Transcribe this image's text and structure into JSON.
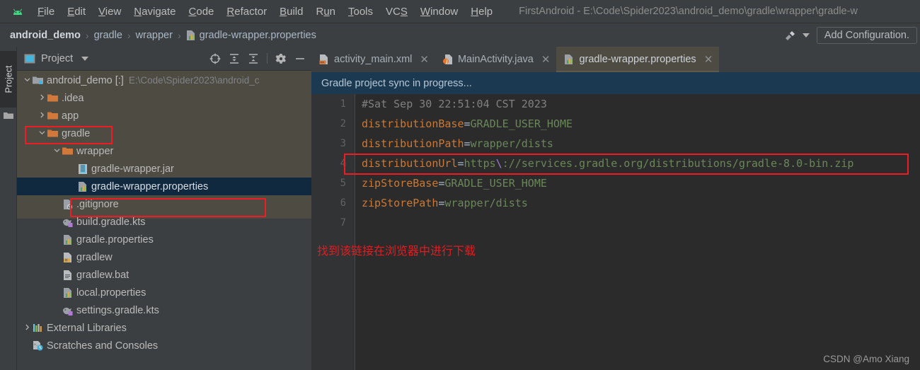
{
  "window": {
    "title": "FirstAndroid - E:\\Code\\Spider2023\\android_demo\\gradle\\wrapper\\gradle-w",
    "app_icon": "android-logo-icon"
  },
  "menubar": {
    "items": [
      {
        "label": "File",
        "mnemonic": "F"
      },
      {
        "label": "Edit",
        "mnemonic": "E"
      },
      {
        "label": "View",
        "mnemonic": "V"
      },
      {
        "label": "Navigate",
        "mnemonic": "N"
      },
      {
        "label": "Code",
        "mnemonic": "C"
      },
      {
        "label": "Refactor",
        "mnemonic": "R"
      },
      {
        "label": "Build",
        "mnemonic": "B"
      },
      {
        "label": "Run",
        "mnemonic": "u"
      },
      {
        "label": "Tools",
        "mnemonic": "T"
      },
      {
        "label": "VCS",
        "mnemonic": "S"
      },
      {
        "label": "Window",
        "mnemonic": "W"
      },
      {
        "label": "Help",
        "mnemonic": "H"
      }
    ]
  },
  "breadcrumb": {
    "separator": "›",
    "items": [
      {
        "label": "android_demo",
        "icon": ""
      },
      {
        "label": "gradle",
        "icon": ""
      },
      {
        "label": "wrapper",
        "icon": ""
      },
      {
        "label": "gradle-wrapper.properties",
        "icon": "properties-file-icon"
      }
    ]
  },
  "toolbar_right": {
    "device_icon": "run-device-icon",
    "dropdown_icon": "chevron-down-icon",
    "add_configuration_label": "Add Configuration."
  },
  "tool_window_strip": {
    "project_tab_label": "Project",
    "folder_icon": "folder-icon"
  },
  "project_panel": {
    "title": "Project",
    "dropdown_icon": "chevron-down-icon",
    "icons": [
      {
        "name": "locate-target-icon"
      },
      {
        "name": "expand-all-icon"
      },
      {
        "name": "collapse-all-icon"
      },
      {
        "name": "settings-gear-icon"
      },
      {
        "name": "hide-minimize-icon"
      }
    ],
    "tree": [
      {
        "label": "android_demo",
        "suffix": "[:]",
        "subpath": "E:\\Code\\Spider2023\\android_c",
        "indent": 0,
        "arrow": "expanded",
        "icon": "module-icon",
        "selected": false,
        "highlight": false
      },
      {
        "label": ".idea",
        "subpath": "",
        "indent": 1,
        "arrow": "collapsed",
        "icon": "folder-icon",
        "selected": false,
        "highlight": false
      },
      {
        "label": "app",
        "subpath": "",
        "indent": 1,
        "arrow": "collapsed",
        "icon": "folder-icon",
        "selected": false,
        "highlight": false
      },
      {
        "label": "gradle",
        "subpath": "",
        "indent": 1,
        "arrow": "expanded",
        "icon": "folder-icon",
        "selected": false,
        "highlight": true
      },
      {
        "label": "wrapper",
        "subpath": "",
        "indent": 2,
        "arrow": "expanded",
        "icon": "folder-icon",
        "selected": false,
        "highlight": false
      },
      {
        "label": "gradle-wrapper.jar",
        "subpath": "",
        "indent": 3,
        "arrow": "none",
        "icon": "jar-file-icon",
        "selected": false,
        "highlight": false
      },
      {
        "label": "gradle-wrapper.properties",
        "subpath": "",
        "indent": 3,
        "arrow": "none",
        "icon": "properties-file-icon",
        "selected": true,
        "highlight": true
      },
      {
        "label": ".gitignore",
        "subpath": "",
        "indent": 2,
        "arrow": "none",
        "icon": "gitignore-file-icon",
        "selected": false,
        "highlight": false
      },
      {
        "label": "build.gradle.kts",
        "subpath": "",
        "indent": 2,
        "arrow": "none",
        "icon": "gradle-kts-file-icon",
        "selected": false,
        "highlight": false
      },
      {
        "label": "gradle.properties",
        "subpath": "",
        "indent": 2,
        "arrow": "none",
        "icon": "properties-file-icon",
        "selected": false,
        "highlight": false
      },
      {
        "label": "gradlew",
        "subpath": "",
        "indent": 2,
        "arrow": "none",
        "icon": "shell-script-file-icon",
        "selected": false,
        "highlight": false
      },
      {
        "label": "gradlew.bat",
        "subpath": "",
        "indent": 2,
        "arrow": "none",
        "icon": "bat-file-icon",
        "selected": false,
        "highlight": false
      },
      {
        "label": "local.properties",
        "subpath": "",
        "indent": 2,
        "arrow": "none",
        "icon": "properties-file-icon",
        "selected": false,
        "highlight": false
      },
      {
        "label": "settings.gradle.kts",
        "subpath": "",
        "indent": 2,
        "arrow": "none",
        "icon": "gradle-kts-file-icon",
        "selected": false,
        "highlight": false
      },
      {
        "label": "External Libraries",
        "subpath": "",
        "indent": 0,
        "arrow": "collapsed",
        "icon": "libraries-icon",
        "selected": false,
        "highlight": false
      },
      {
        "label": "Scratches and Consoles",
        "subpath": "",
        "indent": 0,
        "arrow": "none",
        "icon": "scratches-icon",
        "selected": false,
        "highlight": false
      }
    ]
  },
  "editor": {
    "tabs": [
      {
        "label": "activity_main.xml",
        "icon": "xml-layout-file-icon",
        "active": false,
        "close_icon": "close-icon"
      },
      {
        "label": "MainActivity.java",
        "icon": "java-file-icon",
        "active": false,
        "close_icon": "close-icon"
      },
      {
        "label": "gradle-wrapper.properties",
        "icon": "properties-file-icon",
        "active": true,
        "close_icon": "close-icon"
      }
    ],
    "sync_banner": "Gradle project sync in progress...",
    "line_numbers": [
      "1",
      "2",
      "3",
      "4",
      "5",
      "6",
      "7"
    ],
    "lines": [
      {
        "n": 1,
        "tokens": [
          {
            "t": "#Sat Sep 30 22:51:04 CST 2023",
            "c": "comment"
          }
        ],
        "highlight": false
      },
      {
        "n": 2,
        "tokens": [
          {
            "t": "distributionBase",
            "c": "key"
          },
          {
            "t": "=",
            "c": "eq"
          },
          {
            "t": "GRADLE_USER_HOME",
            "c": "val"
          }
        ],
        "highlight": false
      },
      {
        "n": 3,
        "tokens": [
          {
            "t": "distributionPath",
            "c": "key"
          },
          {
            "t": "=",
            "c": "eq"
          },
          {
            "t": "wrapper/dists",
            "c": "val"
          }
        ],
        "highlight": false
      },
      {
        "n": 4,
        "tokens": [
          {
            "t": "distributionUrl",
            "c": "key"
          },
          {
            "t": "=",
            "c": "eq"
          },
          {
            "t": "https",
            "c": "val"
          },
          {
            "t": "\\",
            "c": "esc"
          },
          {
            "t": "://services.gradle.org/distributions/gradle-8.0-bin.zip",
            "c": "val"
          }
        ],
        "highlight": true
      },
      {
        "n": 5,
        "tokens": [
          {
            "t": "zipStoreBase",
            "c": "key"
          },
          {
            "t": "=",
            "c": "eq"
          },
          {
            "t": "GRADLE_USER_HOME",
            "c": "val"
          }
        ],
        "highlight": false
      },
      {
        "n": 6,
        "tokens": [
          {
            "t": "zipStorePath",
            "c": "key"
          },
          {
            "t": "=",
            "c": "eq"
          },
          {
            "t": "wrapper/dists",
            "c": "val"
          }
        ],
        "highlight": false
      },
      {
        "n": 7,
        "tokens": [],
        "highlight": false
      }
    ],
    "annotation": "找到该链接在浏览器中进行下载",
    "watermark": "CSDN @Amo Xiang"
  },
  "colors": {
    "panel_bg": "#3c3f41",
    "editor_bg": "#2b2b2b",
    "gutter_bg": "#313335",
    "selection_blue": "#11293f",
    "active_tab": "#4e4b42",
    "sync_banner_bg": "#1b3a52",
    "annotation_red": "#e51b20",
    "highlight_red": "#ee1c25",
    "key_orange": "#cc7832",
    "value_green": "#6a8759",
    "comment_gray": "#808080"
  }
}
